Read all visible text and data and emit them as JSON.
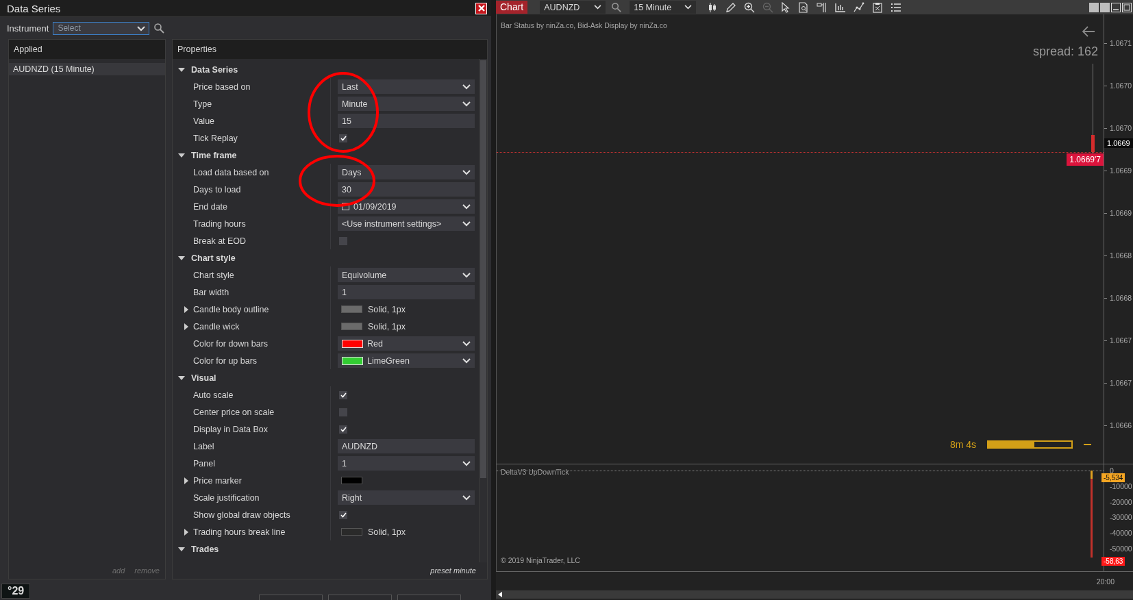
{
  "dialog": {
    "title": "Data Series",
    "instrument": {
      "label": "Instrument",
      "placeholder": "Select"
    },
    "applied": {
      "header": "Applied",
      "items": [
        {
          "label": "AUDNZD (15 Minute)",
          "selected": true
        }
      ],
      "actions": [
        "add",
        "remove"
      ]
    },
    "properties": {
      "header": "Properties",
      "footer": "preset minute",
      "categories": [
        {
          "label": "Data Series",
          "expanded": true,
          "rows": [
            {
              "label": "Price based on",
              "kind": "dropdown",
              "value": "Last"
            },
            {
              "label": "Type",
              "kind": "dropdown",
              "value": "Minute"
            },
            {
              "label": "Value",
              "kind": "text",
              "value": "15"
            },
            {
              "label": "Tick Replay",
              "kind": "checkbox",
              "checked": true
            }
          ]
        },
        {
          "label": "Time frame",
          "expanded": true,
          "rows": [
            {
              "label": "Load data based on",
              "kind": "dropdown",
              "value": "Days"
            },
            {
              "label": "Days to load",
              "kind": "text",
              "value": "30"
            },
            {
              "label": "End date",
              "kind": "date",
              "value": "01/09/2019"
            },
            {
              "label": "Trading hours",
              "kind": "dropdown",
              "value": "<Use instrument settings>"
            },
            {
              "label": "Break at EOD",
              "kind": "checkbox",
              "checked": false
            }
          ]
        },
        {
          "label": "Chart style",
          "expanded": true,
          "rows": [
            {
              "label": "Chart style",
              "kind": "dropdown",
              "value": "Equivolume"
            },
            {
              "label": "Bar width",
              "kind": "text",
              "value": "1"
            },
            {
              "label": "Candle body outline",
              "kind": "stroke",
              "value": "Solid, 1px",
              "color": "#6b6b6b"
            },
            {
              "label": "Candle wick",
              "kind": "stroke",
              "value": "Solid, 1px",
              "color": "#6b6b6b"
            },
            {
              "label": "Color for down bars",
              "kind": "color",
              "value": "Red",
              "color": "#ff0000"
            },
            {
              "label": "Color for up bars",
              "kind": "color",
              "value": "LimeGreen",
              "color": "#32cd32"
            }
          ]
        },
        {
          "label": "Visual",
          "expanded": true,
          "rows": [
            {
              "label": "Auto scale",
              "kind": "checkbox",
              "checked": true
            },
            {
              "label": "Center price on scale",
              "kind": "checkbox",
              "checked": false
            },
            {
              "label": "Display in Data Box",
              "kind": "checkbox",
              "checked": true
            },
            {
              "label": "Label",
              "kind": "text",
              "value": "AUDNZD"
            },
            {
              "label": "Panel",
              "kind": "dropdown",
              "value": "1"
            },
            {
              "label": "Price marker",
              "kind": "swatch",
              "color": "#000000"
            },
            {
              "label": "Scale justification",
              "kind": "dropdown",
              "value": "Right"
            },
            {
              "label": "Show global draw objects",
              "kind": "checkbox",
              "checked": true
            },
            {
              "label": "Trading hours break line",
              "kind": "stroke",
              "value": "Solid, 1px",
              "color": "#2a2a2a"
            }
          ]
        },
        {
          "label": "Trades",
          "expanded": true
        }
      ]
    },
    "badge": "°29"
  },
  "chart": {
    "tab": "Chart",
    "instrument": "AUDNZD",
    "interval": "15 Minute",
    "indicators_note": "Bar Status by ninZa.co, Bid-Ask Display by ninZa.co",
    "spread": "spread: 162",
    "price_axis": [
      "1.0671",
      "1.0670",
      "1.0670",
      "1.0669",
      "1.0669",
      "1.0668",
      "1.0668",
      "1.0667",
      "1.0667",
      "1.0666"
    ],
    "last_price_tag": "1.0669'7",
    "axis_price_tag": "1.0669",
    "timer": {
      "text": "8m 4s",
      "level": 0.55
    },
    "lower_panel": {
      "title": "DeltaV3 UpDownTick",
      "copyright": "© 2019 NinjaTrader, LLC",
      "axis": [
        "0",
        "-10000",
        "-20000",
        "-30000",
        "-40000",
        "-50000"
      ],
      "tags": [
        {
          "text": "-5,534",
          "color": "#f5a623"
        },
        {
          "text": "-58,63",
          "color": "#ff1a1a"
        }
      ]
    },
    "time_axis": [
      "20:00"
    ]
  }
}
